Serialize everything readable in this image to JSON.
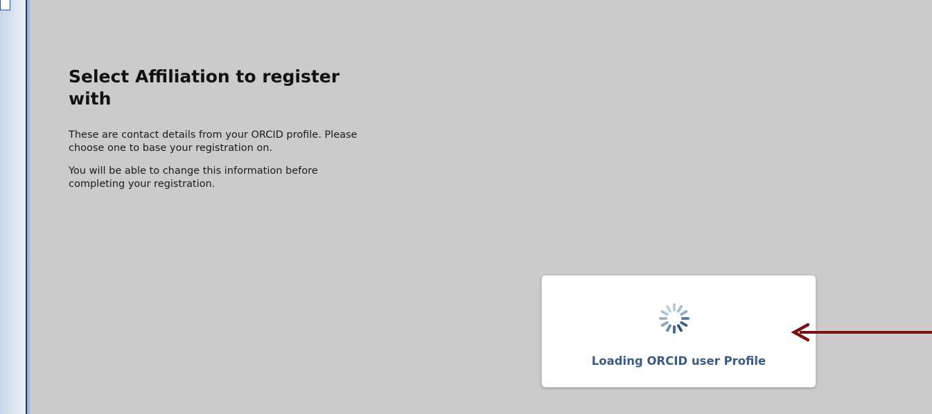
{
  "page": {
    "heading": "Select Affiliation to register with",
    "paragraph_1": "These are contact details from your ORCID profile. Please choose one to base your registration on.",
    "paragraph_2": "You will be able to change this information before completing your registration."
  },
  "loading": {
    "text": "Loading ORCID user Profile",
    "spinner_icon": "spinner-icon"
  },
  "annotation": {
    "arrow_icon": "arrow-left-icon",
    "arrow_color": "#7a1414"
  },
  "colors": {
    "background": "#cbcbcb",
    "rail_accent": "#20365f",
    "loading_text": "#3d5b80"
  }
}
